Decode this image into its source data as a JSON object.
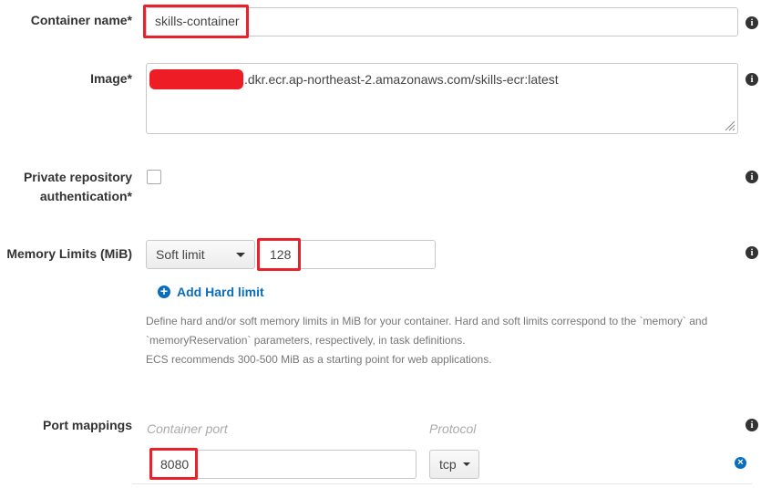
{
  "container_name": {
    "label": "Container name*",
    "value": "skills-container"
  },
  "image": {
    "label": "Image*",
    "value": ".dkr.ecr.ap-northeast-2.amazonaws.com/skills-ecr:latest"
  },
  "private_repo": {
    "label_line1": "Private repository",
    "label_line2": "authentication*",
    "checked": false
  },
  "memory": {
    "label": "Memory Limits (MiB)",
    "limit_type": "Soft limit",
    "value": "128",
    "add_hard_limit_label": "Add Hard limit",
    "help_line1": "Define hard and/or soft memory limits in MiB for your container. Hard and soft limits correspond to the `memory` and",
    "help_line2": "`memoryReservation` parameters, respectively, in task definitions.",
    "help_line3": "ECS recommends 300-500 MiB as a starting point for web applications."
  },
  "port_mappings": {
    "label": "Port mappings",
    "container_port_header": "Container port",
    "protocol_header": "Protocol",
    "rows": [
      {
        "container_port": "8080",
        "protocol": "tcp"
      }
    ]
  },
  "colors": {
    "highlight": "#e8212b",
    "link": "#0a6ebd",
    "redaction": "#ee1c25"
  }
}
